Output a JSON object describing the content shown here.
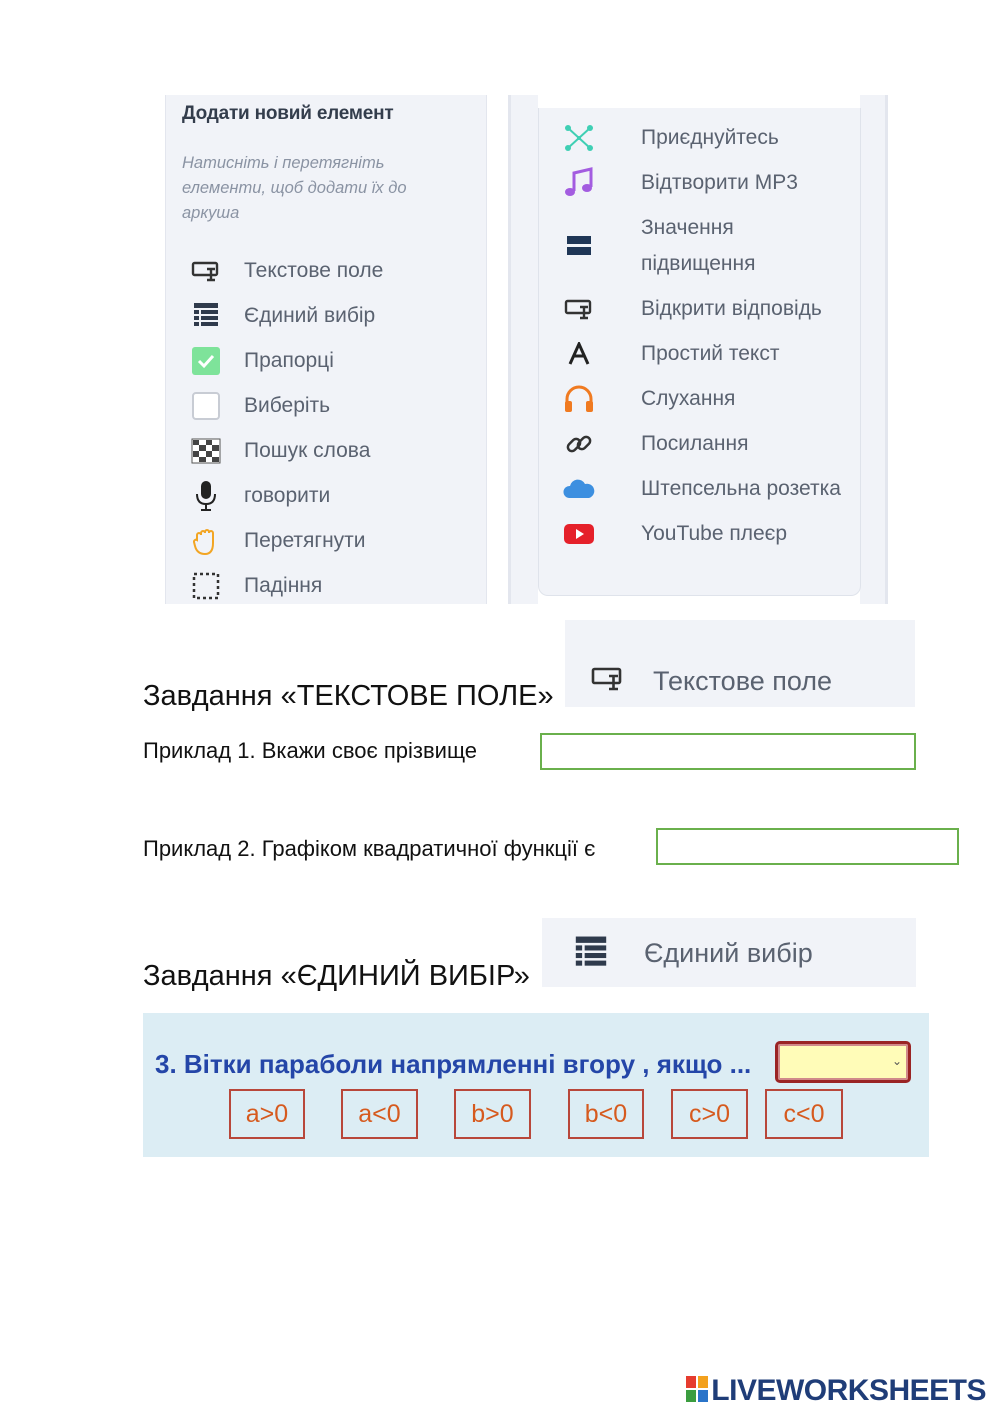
{
  "left_panel": {
    "title": "Додати новий елемент",
    "hint": "Натисніть і перетягніть елементи, щоб додати їх до аркуша",
    "items": [
      {
        "label": "Текстове поле",
        "icon": "text-field-icon"
      },
      {
        "label": "Єдиний вибір",
        "icon": "list-icon"
      },
      {
        "label": "Прапорці",
        "icon": "checkbox-checked-icon"
      },
      {
        "label": "Виберіть",
        "icon": "checkbox-empty-icon"
      },
      {
        "label": "Пошук слова",
        "icon": "word-search-icon"
      },
      {
        "label": "говорити",
        "icon": "microphone-icon"
      },
      {
        "label": "Перетягнути",
        "icon": "hand-icon"
      },
      {
        "label": "Падіння",
        "icon": "dotted-square-icon"
      }
    ]
  },
  "right_panel": {
    "items": [
      {
        "label": "Приєднуйтесь",
        "icon": "join-icon"
      },
      {
        "label": "Відтворити MP3",
        "icon": "music-note-icon"
      },
      {
        "label": "Значення",
        "label2": "підвищення",
        "icon": "bars-icon"
      },
      {
        "label": "Відкрити відповідь",
        "icon": "open-answer-icon"
      },
      {
        "label": "Простий текст",
        "icon": "letter-a-icon"
      },
      {
        "label": "Слухання",
        "icon": "headphones-icon"
      },
      {
        "label": "Посилання",
        "icon": "link-icon"
      },
      {
        "label": "Штепсельна розетка",
        "icon": "cloud-icon"
      },
      {
        "label": "YouTube плеєр",
        "icon": "youtube-icon"
      }
    ]
  },
  "text_field_section": {
    "heading": "Завдання «ТЕКСТОВЕ ПОЛЕ»",
    "badge_label": "Текстове поле",
    "example1": "Приклад 1.  Вкажи своє прізвище",
    "example2": "Приклад 2. Графіком квадратичної функції є"
  },
  "single_choice_section": {
    "heading": "Завдання «ЄДИНИЙ ВИБІР»",
    "badge_label": "Єдиний вибір",
    "question": "3. Вітки параболи напрямленні вгору , якщо ...",
    "options": [
      "a>0",
      "a<0",
      "b>0",
      "b<0",
      "c>0",
      "c<0"
    ],
    "select_value": ""
  },
  "footer": {
    "logo_text": "LIVEWORKSHEETS",
    "logo_colors": [
      "#e63c2f",
      "#f3a11d",
      "#3b9d3f",
      "#2a74c9"
    ]
  }
}
